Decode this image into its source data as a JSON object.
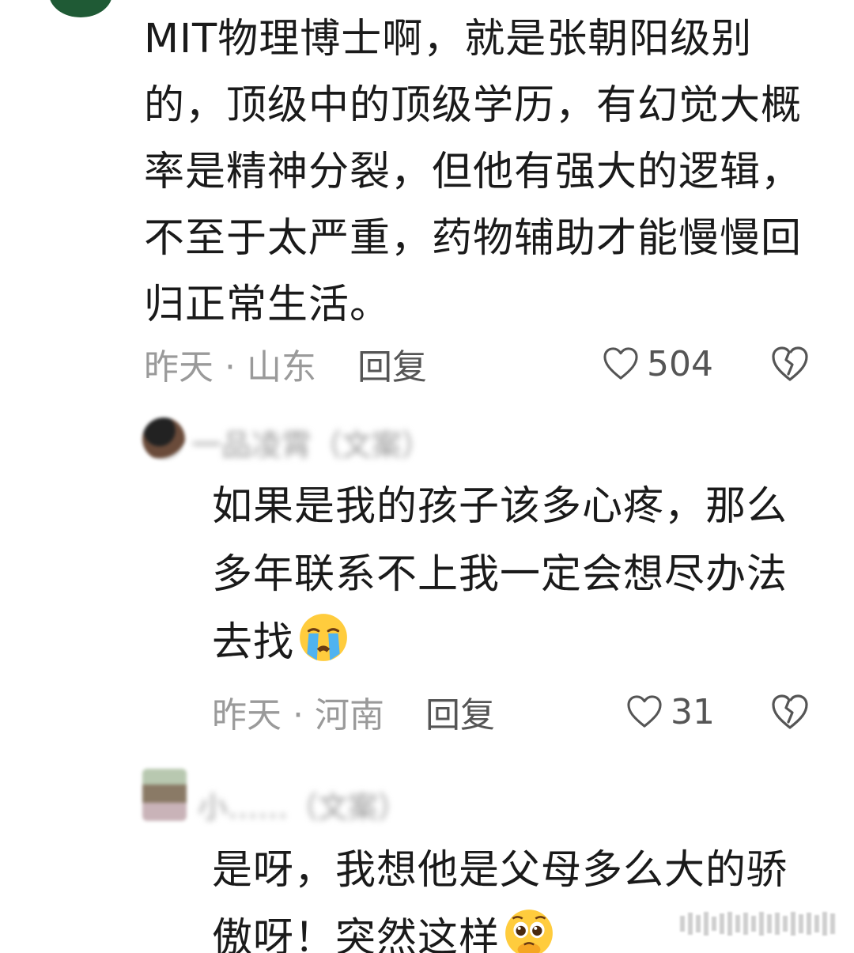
{
  "comment": {
    "text": "MIT物理博士啊，就是张朝阳级别的，顶级中的顶级学历，有幻觉大概率是精神分裂，但他有强大的逻辑，不至于太严重，药物辅助才能慢慢回归正常生活。",
    "time": "昨天 · 山东",
    "reply_label": "回复",
    "likes": "504"
  },
  "replies": [
    {
      "username": "一品凌霄（文案）",
      "text": "如果是我的孩子该多心疼，那么多年联系不上我一定会想尽办法去找",
      "emoji": "crying-face",
      "time": "昨天 · 河南",
      "reply_label": "回复",
      "likes": "31"
    },
    {
      "username": "小……（文案）",
      "text": "是呀，我想他是父母多么大的骄傲呀！突然这样",
      "emoji": "pleading-face"
    }
  ],
  "colors": {
    "meta": "#9a9a9a",
    "text": "#1a1a1a",
    "avatar_top": "#1f5a35"
  }
}
